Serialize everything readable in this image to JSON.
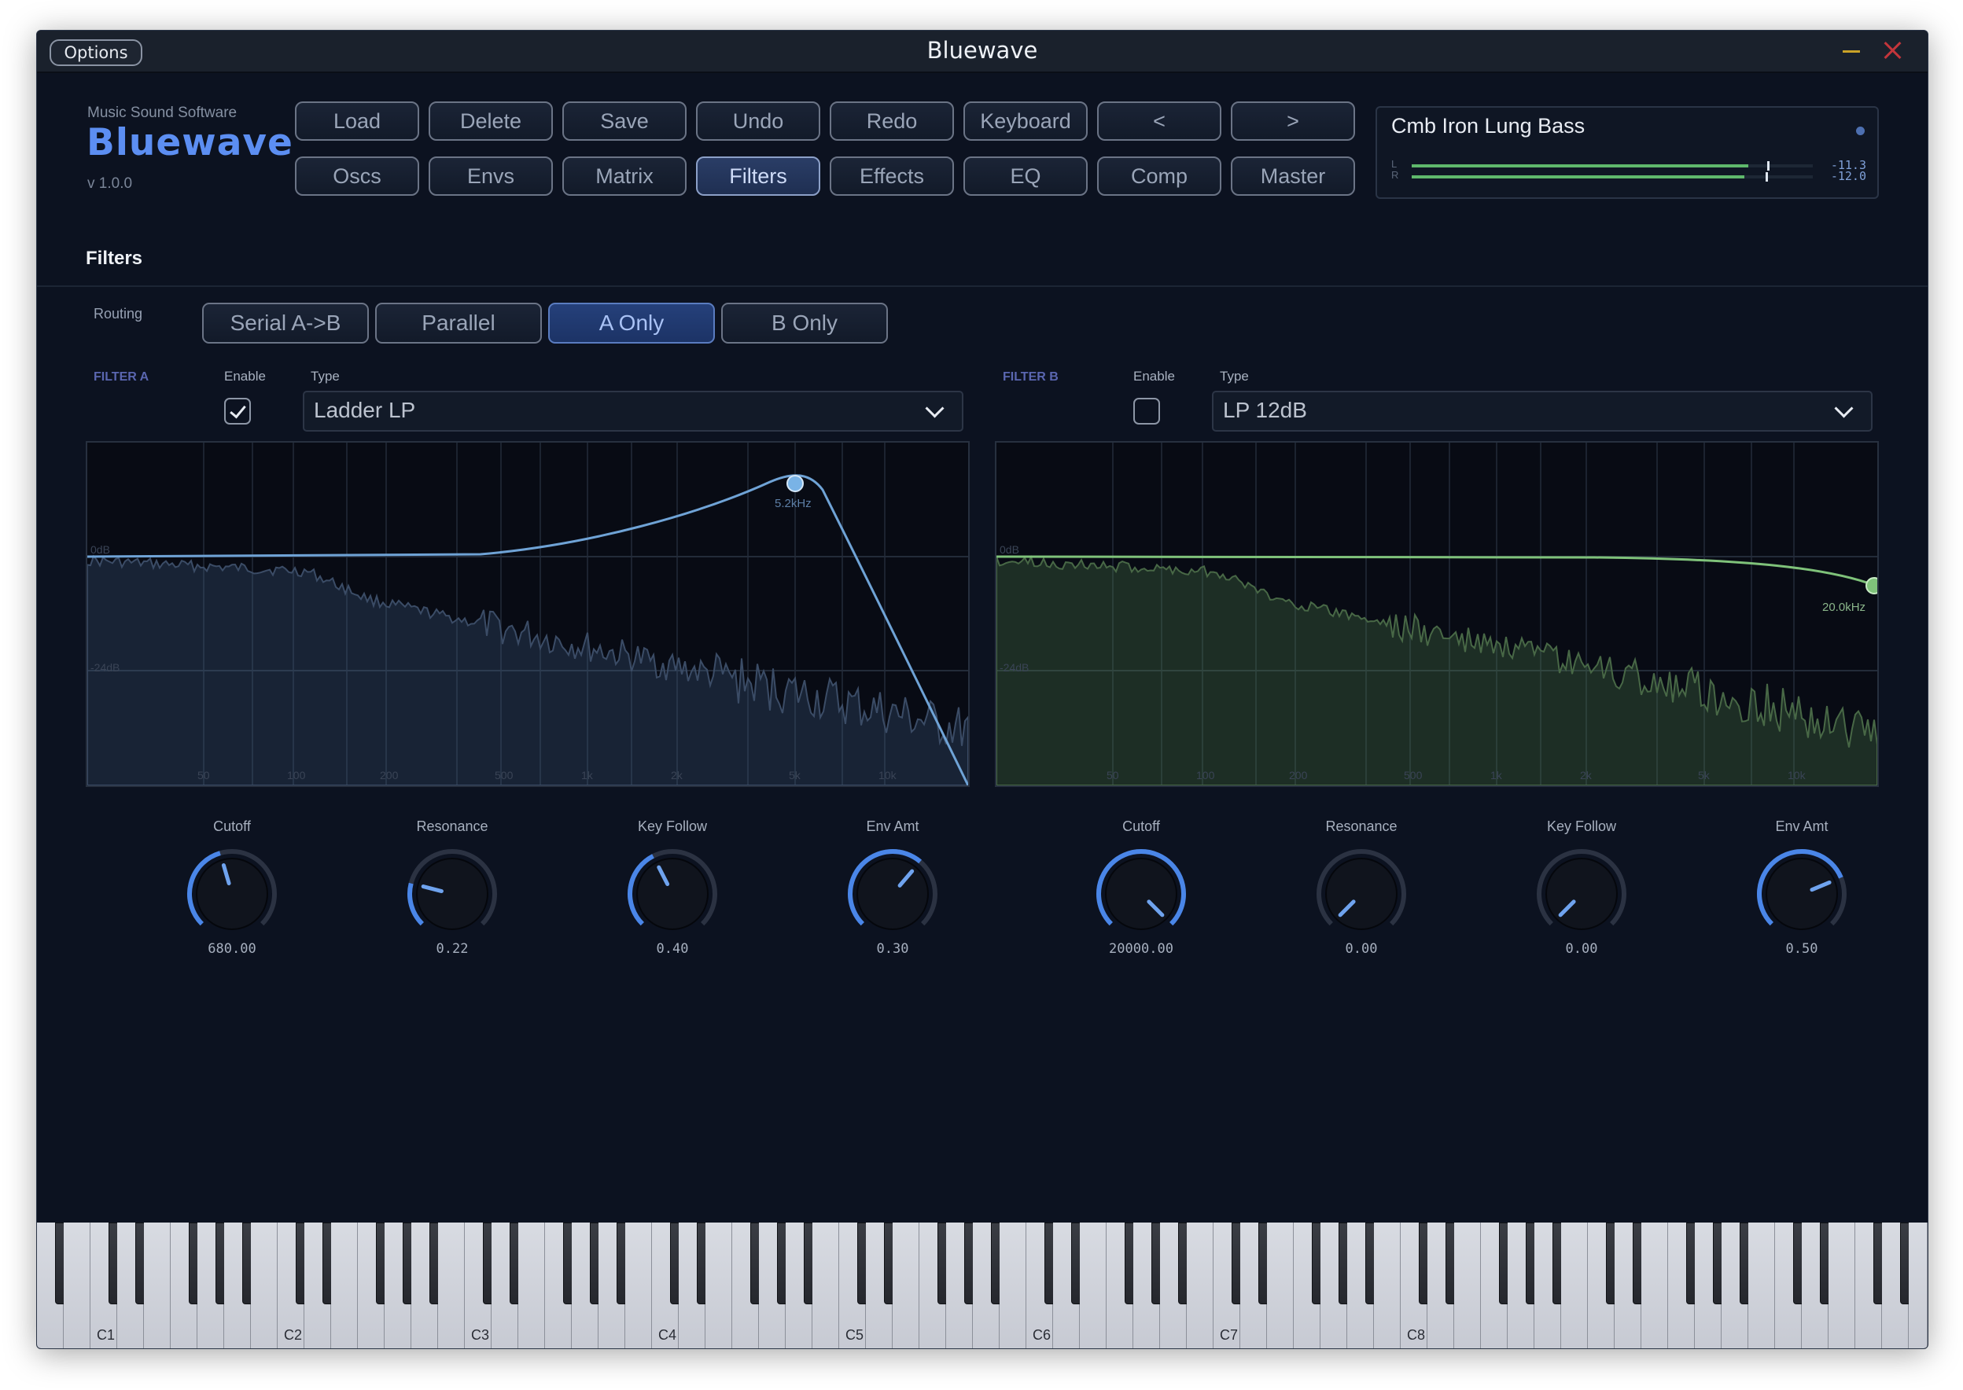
{
  "window": {
    "title": "Bluewave",
    "options_label": "Options"
  },
  "brand": {
    "small": "Music Sound Software",
    "logo": "Bluewave",
    "version": "v 1.0.0"
  },
  "nav": {
    "row1": [
      "Load",
      "Delete",
      "Save",
      "Undo",
      "Redo",
      "Keyboard",
      "<",
      ">"
    ],
    "row2": [
      "Oscs",
      "Envs",
      "Matrix",
      "Filters",
      "Effects",
      "EQ",
      "Comp",
      "Master"
    ],
    "active": "Filters"
  },
  "preset": {
    "name": "Cmb Iron Lung Bass",
    "meters": [
      {
        "label": "L",
        "value": "-11.3",
        "level": 0.84,
        "peak": 0.886
      },
      {
        "label": "R",
        "value": "-12.0",
        "level": 0.83,
        "peak": 0.882
      }
    ]
  },
  "section": {
    "title": "Filters",
    "routing_label": "Routing"
  },
  "routing": {
    "options": [
      "Serial A->B",
      "Parallel",
      "A Only",
      "B Only"
    ],
    "active": "A Only"
  },
  "filter_a": {
    "header": "FILTER A",
    "enable_label": "Enable",
    "type_label": "Type",
    "enabled": true,
    "type": "Ladder LP",
    "freq_marker": "5.2kHz",
    "db_labels": [
      "0dB",
      "-24dB"
    ],
    "freq_ticks": [
      "50",
      "100",
      "200",
      "500",
      "1k",
      "2k",
      "5k",
      "10k"
    ],
    "knobs": [
      {
        "label": "Cutoff",
        "value": "680.00",
        "pos": 0.44
      },
      {
        "label": "Resonance",
        "value": "0.22",
        "pos": 0.22
      },
      {
        "label": "Key Follow",
        "value": "0.40",
        "pos": 0.4
      },
      {
        "label": "Env Amt",
        "value": "0.30",
        "pos": 0.65
      }
    ]
  },
  "filter_b": {
    "header": "FILTER B",
    "enable_label": "Enable",
    "type_label": "Type",
    "enabled": false,
    "type": "LP 12dB",
    "freq_marker": "20.0kHz",
    "db_labels": [
      "0dB",
      "-24dB"
    ],
    "freq_ticks": [
      "50",
      "100",
      "200",
      "500",
      "1k",
      "2k",
      "5k",
      "10k"
    ],
    "knobs": [
      {
        "label": "Cutoff",
        "value": "20000.00",
        "pos": 1.0
      },
      {
        "label": "Resonance",
        "value": "0.00",
        "pos": 0.0
      },
      {
        "label": "Key Follow",
        "value": "0.00",
        "pos": 0.0
      },
      {
        "label": "Env Amt",
        "value": "0.50",
        "pos": 0.75
      }
    ]
  },
  "keyboard": {
    "labels": [
      "C1",
      "C2",
      "C3",
      "C4",
      "C5",
      "C6",
      "C7",
      "C8"
    ]
  },
  "colors": {
    "accent": "#5c8ef2",
    "filter_a_curve": "#6fa3d6",
    "filter_b_curve": "#7fc27a",
    "knob_arc": "#4a86e8"
  }
}
